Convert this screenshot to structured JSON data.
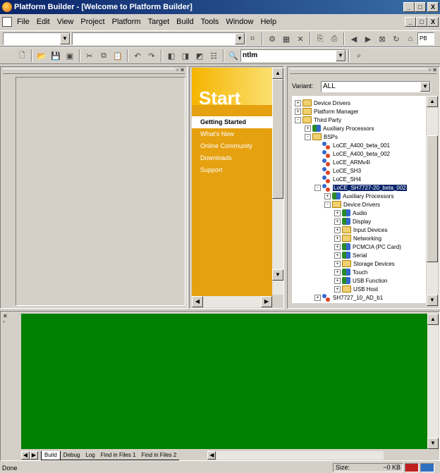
{
  "window": {
    "title": "Platform Builder - [Welcome to Platform Builder]",
    "buttons": [
      "_",
      "□",
      "X"
    ]
  },
  "menu": {
    "items": [
      {
        "label": "File",
        "u": "F",
        "rest": "ile"
      },
      {
        "label": "Edit",
        "u": "E",
        "rest": "dit"
      },
      {
        "label": "View",
        "u": "V",
        "rest": "iew"
      },
      {
        "label": "Project",
        "u": "P",
        "rest": "roject"
      },
      {
        "label": "Platform",
        "u": "",
        "rest": "Platform"
      },
      {
        "label": "Target",
        "u": "",
        "rest": "Target"
      },
      {
        "label": "Build",
        "u": "B",
        "rest": "uild"
      },
      {
        "label": "Tools",
        "u": "T",
        "rest": "ools"
      },
      {
        "label": "Window",
        "u": "W",
        "rest": "indow"
      },
      {
        "label": "Help",
        "u": "H",
        "rest": "elp"
      }
    ],
    "mdi_buttons": [
      "_",
      "□",
      "X"
    ]
  },
  "toolbar": {
    "pb_combo": "PB De",
    "search_combo": "ntlm"
  },
  "start": {
    "heading": "Start",
    "links": [
      "Getting Started",
      "What's New",
      "Online Community",
      "Downloads",
      "Support"
    ],
    "selected": 0
  },
  "variant": {
    "label": "Variant:",
    "value": "ALL"
  },
  "tree": [
    {
      "label": "Device Drivers",
      "icon": "folder",
      "level": 0,
      "exp": "+"
    },
    {
      "label": "Platform Manager",
      "icon": "folder",
      "level": 0,
      "exp": "+"
    },
    {
      "label": "Third Party",
      "icon": "folder",
      "level": 0,
      "exp": "-"
    },
    {
      "label": "Auxiliary Processors",
      "icon": "component",
      "level": 1,
      "exp": "+"
    },
    {
      "label": "BSPs",
      "icon": "folder",
      "level": 1,
      "exp": "-"
    },
    {
      "label": "LoCE_A400_beta_001",
      "icon": "bsp",
      "level": 2,
      "exp": ""
    },
    {
      "label": "LoCE_A400_beta_002",
      "icon": "bsp",
      "level": 2,
      "exp": ""
    },
    {
      "label": "LoCE_ARMv4I",
      "icon": "bsp",
      "level": 2,
      "exp": ""
    },
    {
      "label": "LoCE_SH3",
      "icon": "bsp",
      "level": 2,
      "exp": ""
    },
    {
      "label": "LoCE_SH4",
      "icon": "bsp",
      "level": 2,
      "exp": ""
    },
    {
      "label": "LoCE_SH7727-20_beta_002",
      "icon": "bsp",
      "level": 2,
      "exp": "-",
      "selected": true
    },
    {
      "label": "Auxiliary Processors",
      "icon": "component",
      "level": 3,
      "exp": "+"
    },
    {
      "label": "Device Drivers",
      "icon": "folder",
      "level": 3,
      "exp": "-"
    },
    {
      "label": "Audio",
      "icon": "component",
      "level": 4,
      "exp": "+"
    },
    {
      "label": "Display",
      "icon": "component",
      "level": 4,
      "exp": "+"
    },
    {
      "label": "Input Devices",
      "icon": "folder",
      "level": 4,
      "exp": "+"
    },
    {
      "label": "Networking",
      "icon": "folder",
      "level": 4,
      "exp": "+"
    },
    {
      "label": "PCMCIA (PC Card)",
      "icon": "component",
      "level": 4,
      "exp": "+"
    },
    {
      "label": "Serial",
      "icon": "component",
      "level": 4,
      "exp": "+"
    },
    {
      "label": "Storage Devices",
      "icon": "folder",
      "level": 4,
      "exp": "+"
    },
    {
      "label": "Touch",
      "icon": "component",
      "level": 4,
      "exp": "+"
    },
    {
      "label": "USB Function",
      "icon": "component",
      "level": 4,
      "exp": "+"
    },
    {
      "label": "USB Host",
      "icon": "folder",
      "level": 4,
      "exp": "+"
    },
    {
      "label": "SH7727_10_AD_b1",
      "icon": "bsp",
      "level": 2,
      "exp": "+"
    }
  ],
  "output_tabs": [
    "Build",
    "Debug",
    "Log",
    "Find in Files 1",
    "Find in Files 2"
  ],
  "status": {
    "text": "Done",
    "size_label": "Size:",
    "size_value": "~0 KB"
  }
}
